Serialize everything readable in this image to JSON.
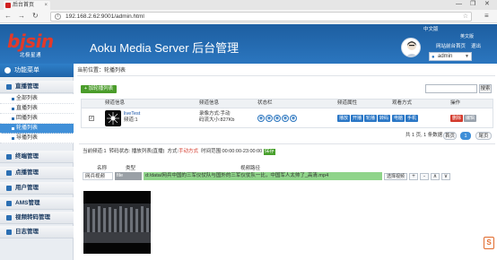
{
  "browser": {
    "tab_title": "后台首页",
    "tab_close": "×",
    "url": "192.168.2.62:9001/admin.html",
    "window_controls": [
      "—",
      "❐",
      "✕"
    ],
    "nav": [
      "←",
      "→",
      "↻"
    ],
    "bookmark_overflow": "移动版书签"
  },
  "header": {
    "logo": "bjsin",
    "logo_sub": "北极星通",
    "title": "Aoku Media Server 后台管理",
    "links": [
      "中文版",
      "英文版",
      "网站前台首页",
      "退出"
    ],
    "user": "admin"
  },
  "sidebar": {
    "title": "功能菜单",
    "groups": [
      {
        "label": "直播管理",
        "items": [
          "全部列表",
          "直播列表",
          "回播列表",
          "轮播列表",
          "导播列表"
        ],
        "active": "轮播列表"
      },
      {
        "label": "终端管理"
      },
      {
        "label": "点播管理"
      },
      {
        "label": "用户管理"
      },
      {
        "label": "AMS管理"
      },
      {
        "label": "视频转码管理"
      },
      {
        "label": "日志管理"
      }
    ]
  },
  "content": {
    "breadcrumb": "当前位置：轮播列表",
    "add_button": "+ 加轮播列表",
    "search_button": "搜索",
    "table": {
      "headers": [
        "频道信息",
        "频道信息",
        "状态栏",
        "频道属性",
        "观看方式",
        "操作"
      ],
      "row": {
        "name": "liveTest",
        "name_sub": "频道:1",
        "info_line1": "录像方式:手动",
        "info_line2": "码流大小:827Kb",
        "status_icons": [
          "◉",
          "◉",
          "◉",
          "◉",
          "◉"
        ],
        "attrs": [
          "播放",
          "开播",
          "轮播",
          "转码"
        ],
        "watch": [
          "电脑",
          "手机"
        ],
        "ops": [
          "删除",
          "编辑"
        ]
      }
    },
    "pager": {
      "summary": "共 1 页, 1 条数据",
      "first": "首页",
      "current": "1",
      "last": "尾页"
    },
    "detail": {
      "channel": "当前频道:1",
      "transcode_label": "转码状态:",
      "transcode_value": "播放列表(直播)",
      "method_label": "方式:",
      "method_value": "手动方式",
      "time_label": "时间范围:",
      "time_value": "00:00:00-23:00:00",
      "save": "保存",
      "col_name": "名称",
      "col_type": "类型",
      "col_path": "视频路径",
      "entry_name": "网兵视频",
      "entry_type": "file",
      "entry_path": "d:/data/网兵中国的三军仪仗队与国外的三军仪仗队一比，中国军人太帅了_高清.mp4",
      "select_button": "选择视频",
      "mini_buttons": [
        "+",
        "-",
        "∧",
        "∨"
      ]
    },
    "corner_label": "S"
  },
  "colors": {
    "header": "#2b76bf",
    "active": "#3f8fd8",
    "green": "#4a9c2a",
    "danger": "#d33a2c"
  }
}
